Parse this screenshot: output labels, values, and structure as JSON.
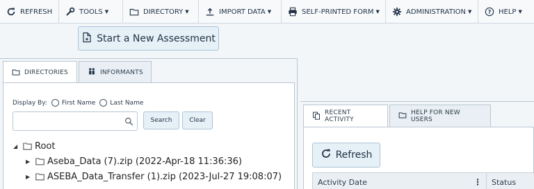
{
  "toolbar": {
    "items": [
      {
        "label": "REFRESH",
        "icon": "refresh-icon"
      },
      {
        "label": "TOOLS",
        "icon": "wrench-icon"
      },
      {
        "label": "DIRECTORY",
        "icon": "folder-icon"
      },
      {
        "label": "IMPORT DATA",
        "icon": "upload-icon"
      },
      {
        "label": "SELF-PRINTED FORM",
        "icon": "printer-icon"
      },
      {
        "label": "ADMINISTRATION",
        "icon": "gear-icon"
      },
      {
        "label": "HELP",
        "icon": "question-icon"
      }
    ]
  },
  "start_button": {
    "label": "Start a New Assessment",
    "icon": "new-document-icon"
  },
  "left_tabs": [
    {
      "label": "DIRECTORIES",
      "icon": "folder-icon",
      "active": true
    },
    {
      "label": "INFORMANTS",
      "icon": "people-icon",
      "active": false
    }
  ],
  "directory": {
    "display_by_label": "Display By:",
    "radio_first": "First Name",
    "radio_last": "Last Name",
    "search_value": "",
    "search_button": "Search",
    "clear_button": "Clear",
    "tree": {
      "root": "Root",
      "children": [
        "Aseba_Data (7).zip (2022-Apr-18 11:36:36)",
        "ASEBA_Data_Transfer (1).zip (2023-Jul-27 19:08:07)"
      ]
    }
  },
  "right_tabs": [
    {
      "label": "RECENT ACTIVITY",
      "icon": "copy-icon",
      "active": true
    },
    {
      "label": "HELP FOR NEW USERS",
      "icon": "folder-icon",
      "active": false
    }
  ],
  "activity": {
    "refresh_button": "Refresh",
    "columns": [
      "Activity Date",
      "Status"
    ]
  },
  "colors": {
    "button_bg": "#e6f0f7",
    "border": "#b8c6d3",
    "text": "#243447"
  }
}
